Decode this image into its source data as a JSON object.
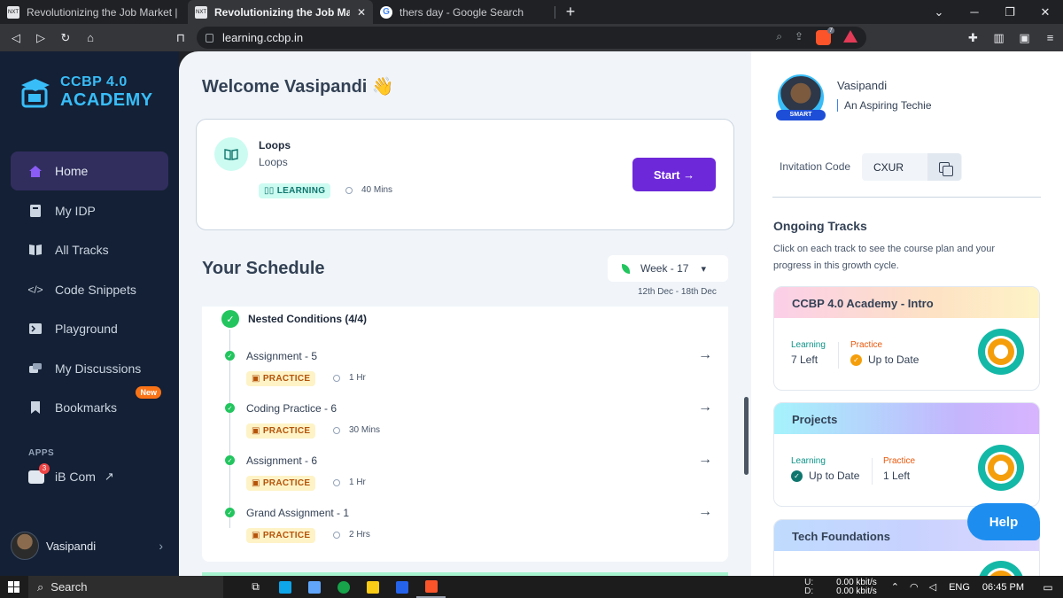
{
  "browser": {
    "tabs": [
      {
        "label": "Revolutionizing the Job Market | NxtW",
        "active": false
      },
      {
        "label": "Revolutionizing the Job Market | ",
        "active": true
      },
      {
        "label": "thers day - Google Search",
        "active": false
      }
    ],
    "url": "learning.ccbp.in",
    "brave_count": "7"
  },
  "sidebar": {
    "logo_line1": "CCBP 4.0",
    "logo_line2": "ACADEMY",
    "items": [
      {
        "label": "Home",
        "icon": "home-icon",
        "active": true
      },
      {
        "label": "My IDP",
        "icon": "document-icon"
      },
      {
        "label": "All Tracks",
        "icon": "book-icon"
      },
      {
        "label": "Code Snippets",
        "icon": "code-icon"
      },
      {
        "label": "Playground",
        "icon": "terminal-icon"
      },
      {
        "label": "My Discussions",
        "icon": "discussion-icon"
      },
      {
        "label": "Bookmarks",
        "icon": "bookmark-icon",
        "badge": "New"
      }
    ],
    "apps_label": "APPS",
    "app_item": {
      "label": "iB Com",
      "badge": "3"
    },
    "user_name": "Vasipandi"
  },
  "main": {
    "welcome": "Welcome Vasipandi 👋",
    "current_card": {
      "title": "Loops",
      "subtitle": "Loops",
      "tag": "LEARNING",
      "duration": "40 Mins",
      "button": "Start →"
    },
    "schedule_title": "Your Schedule",
    "week": "Week - 17",
    "week_range": "12th Dec - 18th Dec",
    "nested_title": "Nested Conditions (4/4)",
    "items": [
      {
        "title": "Assignment - 5",
        "tag": "PRACTICE",
        "duration": "1 Hr"
      },
      {
        "title": "Coding Practice - 6",
        "tag": "PRACTICE",
        "duration": "30 Mins"
      },
      {
        "title": "Assignment - 6",
        "tag": "PRACTICE",
        "duration": "1 Hr"
      },
      {
        "title": "Grand Assignment - 1",
        "tag": "PRACTICE",
        "duration": "2 Hrs"
      }
    ]
  },
  "profile": {
    "name": "Vasipandi",
    "role": "An Aspiring Techie",
    "badge": "SMART",
    "invitation_label": "Invitation Code",
    "invitation_code": "CXUR"
  },
  "ongoing": {
    "title": "Ongoing Tracks",
    "description": "Click on each track to see the course plan and your progress in this growth cycle.",
    "tracks": [
      {
        "name": "CCBP 4.0 Academy - Intro",
        "learning_label": "Learning",
        "learning_value": "7 Left",
        "practice_label": "Practice",
        "practice_value": "Up to Date"
      },
      {
        "name": "Projects",
        "learning_label": "Learning",
        "learning_value": "Up to Date",
        "practice_label": "Practice",
        "practice_value": "1 Left"
      },
      {
        "name": "Tech Foundations"
      }
    ]
  },
  "help_button": "Help",
  "taskbar": {
    "search": "Search",
    "upload_label": "U:",
    "download_label": "D:",
    "upload_speed": "0.00 kbit/s",
    "download_speed": "0.00 kbit/s",
    "language": "ENG",
    "time": "06:45 PM"
  },
  "colors": {
    "accent": "#6d28d9",
    "sidebar_bg": "#142035",
    "learning_green": "#0f766e",
    "practice_orange": "#b45309"
  }
}
